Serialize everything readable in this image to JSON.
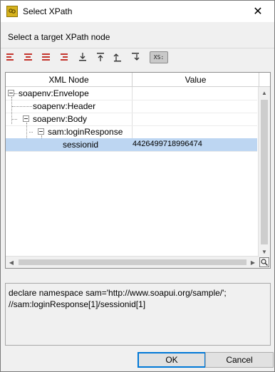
{
  "window": {
    "title": "Select XPath",
    "close_glyph": "✕",
    "subtitle": "Select a target XPath node"
  },
  "toolbar": {
    "icons": [
      "align-left-icon",
      "align-center-icon",
      "align-justify-icon",
      "align-right-icon",
      "collapse-all-icon",
      "expand-all-icon",
      "move-up-icon",
      "move-down-icon"
    ],
    "xs_label": "XS:"
  },
  "tree": {
    "columns": [
      "XML Node",
      "Value"
    ],
    "nodes": [
      {
        "label": "soapenv:Envelope",
        "value": "",
        "depth": 0
      },
      {
        "label": "soapenv:Header",
        "value": "",
        "depth": 1
      },
      {
        "label": "soapenv:Body",
        "value": "",
        "depth": 1
      },
      {
        "label": "sam:loginResponse",
        "value": "",
        "depth": 2
      },
      {
        "label": "sessionid",
        "value": "4426499718996474",
        "depth": 3
      }
    ]
  },
  "xpath": {
    "line1": "declare namespace sam='http://www.soapui.org/sample/';",
    "line2": "//sam:loginResponse[1]/sessionid[1]"
  },
  "buttons": {
    "ok": "OK",
    "cancel": "Cancel"
  },
  "colors": {
    "selection": "#bdd6f2",
    "default_button_border": "#0078d7"
  }
}
